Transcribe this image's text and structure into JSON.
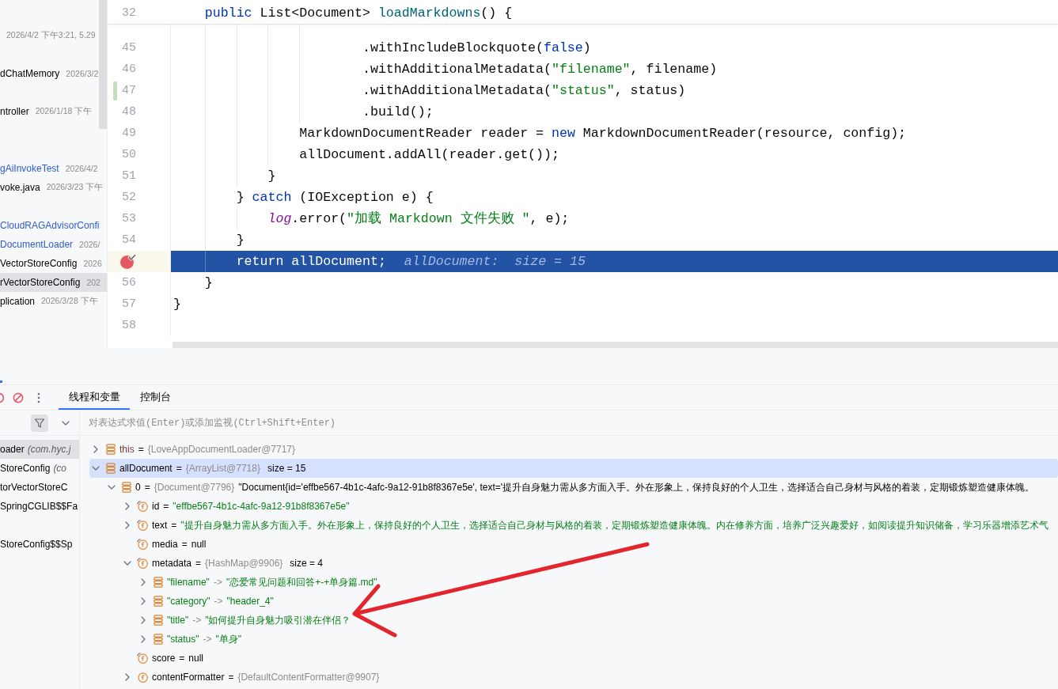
{
  "project_tree": {
    "rows": [
      {
        "kind": "blank"
      },
      {
        "kind": "file",
        "date": "2026/4/2 下午3:21, 5.29",
        "selected": false
      },
      {
        "kind": "blank"
      },
      {
        "kind": "file",
        "name": "dChatMemory",
        "date": "2026/3/2",
        "modified": false,
        "selected": false
      },
      {
        "kind": "blank"
      },
      {
        "kind": "file",
        "name": "ntroller",
        "date": "2026/1/18 下午",
        "modified": false,
        "selected": false
      },
      {
        "kind": "blank"
      },
      {
        "kind": "blank"
      },
      {
        "kind": "file",
        "name": "gAiInvokeTest",
        "date": "2026/4/2",
        "modified": true,
        "selected": false
      },
      {
        "kind": "file",
        "name": "voke.java",
        "date": "2026/3/23 下午",
        "modified": false,
        "selected": false
      },
      {
        "kind": "blank"
      },
      {
        "kind": "file",
        "name": "CloudRAGAdvisorConfi",
        "modified": true,
        "selected": false
      },
      {
        "kind": "file",
        "name": "DocumentLoader",
        "date": "2026/",
        "modified": true,
        "selected": false
      },
      {
        "kind": "file",
        "name": "VectorStoreConfig",
        "date": "2026",
        "modified": false,
        "selected": false
      },
      {
        "kind": "file",
        "name": "rVectorStoreConfig",
        "date": "202",
        "modified": false,
        "selected": true
      },
      {
        "kind": "file",
        "name": "plication",
        "date": "2026/3/28 下午",
        "modified": false,
        "selected": false
      }
    ]
  },
  "editor": {
    "sticky_line": {
      "number": "32",
      "code": [
        {
          "text": "    public",
          "kind": "keyword"
        },
        {
          "text": " List<Document> ",
          "kind": "plain"
        },
        {
          "text": "loadMarkdowns",
          "kind": "method"
        },
        {
          "text": "() {",
          "kind": "plain"
        }
      ]
    },
    "lines": [
      {
        "number": "45",
        "changed": false,
        "breakpoint": false,
        "current": false,
        "code": [
          {
            "text": "                        .withIncludeBlockquote(",
            "kind": "plain"
          },
          {
            "text": "false",
            "kind": "keyword"
          },
          {
            "text": ")",
            "kind": "plain"
          }
        ]
      },
      {
        "number": "46",
        "changed": false,
        "breakpoint": false,
        "current": false,
        "code": [
          {
            "text": "                        .withAdditionalMetadata(",
            "kind": "plain"
          },
          {
            "text": "\"filename\"",
            "kind": "string"
          },
          {
            "text": ", filename)",
            "kind": "plain"
          }
        ]
      },
      {
        "number": "47",
        "changed": true,
        "breakpoint": false,
        "current": false,
        "code": [
          {
            "text": "                        .withAdditionalMetadata(",
            "kind": "plain"
          },
          {
            "text": "\"status\"",
            "kind": "string"
          },
          {
            "text": ", status)",
            "kind": "plain"
          }
        ]
      },
      {
        "number": "48",
        "changed": false,
        "breakpoint": false,
        "current": false,
        "code": [
          {
            "text": "                        .build();",
            "kind": "plain"
          }
        ]
      },
      {
        "number": "49",
        "changed": false,
        "breakpoint": false,
        "current": false,
        "code": [
          {
            "text": "                MarkdownDocumentReader reader = ",
            "kind": "plain"
          },
          {
            "text": "new",
            "kind": "keyword"
          },
          {
            "text": " MarkdownDocumentReader(resource, config);",
            "kind": "plain"
          }
        ]
      },
      {
        "number": "50",
        "changed": false,
        "breakpoint": false,
        "current": false,
        "code": [
          {
            "text": "                allDocument.addAll(reader.get());",
            "kind": "plain"
          }
        ]
      },
      {
        "number": "51",
        "changed": false,
        "breakpoint": false,
        "current": false,
        "code": [
          {
            "text": "            }",
            "kind": "plain"
          }
        ]
      },
      {
        "number": "52",
        "changed": false,
        "breakpoint": false,
        "current": false,
        "code": [
          {
            "text": "        } ",
            "kind": "plain"
          },
          {
            "text": "catch",
            "kind": "keyword"
          },
          {
            "text": " (IOException e) {",
            "kind": "plain"
          }
        ]
      },
      {
        "number": "53",
        "changed": false,
        "breakpoint": false,
        "current": false,
        "code": [
          {
            "text": "            log",
            "kind": "field"
          },
          {
            "text": ".error(",
            "kind": "plain"
          },
          {
            "text": "\"加载 Markdown 文件失败 \"",
            "kind": "string"
          },
          {
            "text": ", e);",
            "kind": "plain"
          }
        ]
      },
      {
        "number": "54",
        "changed": false,
        "breakpoint": false,
        "current": false,
        "code": [
          {
            "text": "        }",
            "kind": "plain"
          }
        ]
      },
      {
        "changed": false,
        "breakpoint": true,
        "current": true,
        "code": [
          {
            "text": "        return",
            "kind": "keyword"
          },
          {
            "text": " allDocument;",
            "kind": "plain"
          }
        ],
        "hint": "allDocument:  size = 15"
      },
      {
        "number": "56",
        "changed": false,
        "breakpoint": false,
        "current": false,
        "code": [
          {
            "text": "    }",
            "kind": "plain"
          }
        ]
      },
      {
        "number": "57",
        "changed": false,
        "breakpoint": false,
        "current": false,
        "code": [
          {
            "text": "}",
            "kind": "plain"
          }
        ]
      },
      {
        "number": "58",
        "changed": false,
        "breakpoint": false,
        "current": false
      }
    ]
  },
  "debug": {
    "tabs": [
      {
        "label": "线程和变量",
        "selected": true
      },
      {
        "label": "控制台",
        "selected": false
      }
    ],
    "expression_field": {
      "placeholder": "对表达式求值(Enter)或添加监视(Ctrl+Shift+Enter)"
    },
    "frames": [
      {
        "kind": "frame",
        "method": "oader",
        "location": "(com.hyc.j",
        "selected": true
      },
      {
        "kind": "frame",
        "method": "StoreConfig",
        "location": "(co",
        "selected": false
      },
      {
        "kind": "frame",
        "method": "torVectorStoreC",
        "selected": false
      },
      {
        "kind": "frame",
        "method": "SpringCGLIB$$Fa",
        "selected": false
      },
      {
        "kind": "blank"
      },
      {
        "kind": "frame",
        "method": "StoreConfig$$Sp",
        "selected": false
      }
    ],
    "variables": [
      {
        "kind": "self",
        "name": "this",
        "op": "=",
        "ref": "{LoveAppDocumentLoader@7717}",
        "expanded": false,
        "selected": false
      },
      {
        "kind": "variable",
        "name": "allDocument",
        "op": "=",
        "ref": "{ArrayList@7718}",
        "size": "size = 15",
        "expanded": true,
        "selected": true,
        "children": [
          {
            "kind": "variable",
            "name": "0",
            "op": "=",
            "ref": "{Document@7796}",
            "summary": "\"Document{id='effbe567-4b1c-4afc-9a12-91b8f8367e5e', text='提升自身魅力需从多方面入手。外在形象上，保持良好的个人卫生，选择适合自己身材与风格的着装，定期锻炼塑造健康体魄。",
            "expanded": true,
            "selected": false,
            "children": [
              {
                "kind": "field",
                "final": true,
                "name": "id",
                "op": "=",
                "value": "\"effbe567-4b1c-4afc-9a12-91b8f8367e5e\"",
                "expanded": false,
                "selected": false
              },
              {
                "kind": "field",
                "final": true,
                "name": "text",
                "op": "=",
                "value": "\"提升自身魅力需从多方面入手。外在形象上，保持良好的个人卫生，选择适合自己身材与风格的着装，定期锻炼塑造健康体魄。内在修养方面，培养广泛兴趣爱好，如阅读提升知识储备，学习乐器增添艺术气",
                "expanded": false,
                "selected": false
              },
              {
                "kind": "field",
                "final": true,
                "name": "media",
                "op": "=",
                "literal": "null",
                "selected": false
              },
              {
                "kind": "field",
                "final": true,
                "name": "metadata",
                "op": "=",
                "ref": "{HashMap@9906}",
                "size": "size = 4",
                "expanded": true,
                "selected": false,
                "children": [
                  {
                    "kind": "entry",
                    "key": "\"filename\"",
                    "op": "->",
                    "value": "\"恋爱常见问题和回答+-+单身篇.md\"",
                    "expanded": false,
                    "selected": false
                  },
                  {
                    "kind": "entry",
                    "key": "\"category\"",
                    "op": "->",
                    "value": "\"header_4\"",
                    "expanded": false,
                    "selected": false
                  },
                  {
                    "kind": "entry",
                    "key": "\"title\"",
                    "op": "->",
                    "value": "\"如何提升自身魅力吸引潜在伴侣？",
                    "expanded": false,
                    "selected": false
                  },
                  {
                    "kind": "entry",
                    "key": "\"status\"",
                    "op": "->",
                    "value": "\"单身\"",
                    "expanded": false,
                    "selected": false
                  }
                ]
              },
              {
                "kind": "field",
                "final": true,
                "name": "score",
                "op": "=",
                "literal": "null",
                "selected": false
              },
              {
                "kind": "field",
                "final": false,
                "name": "contentFormatter",
                "op": "=",
                "ref": "{DefaultContentFormatter@9907}",
                "expanded": false,
                "selected": false
              }
            ]
          }
        ]
      }
    ]
  }
}
